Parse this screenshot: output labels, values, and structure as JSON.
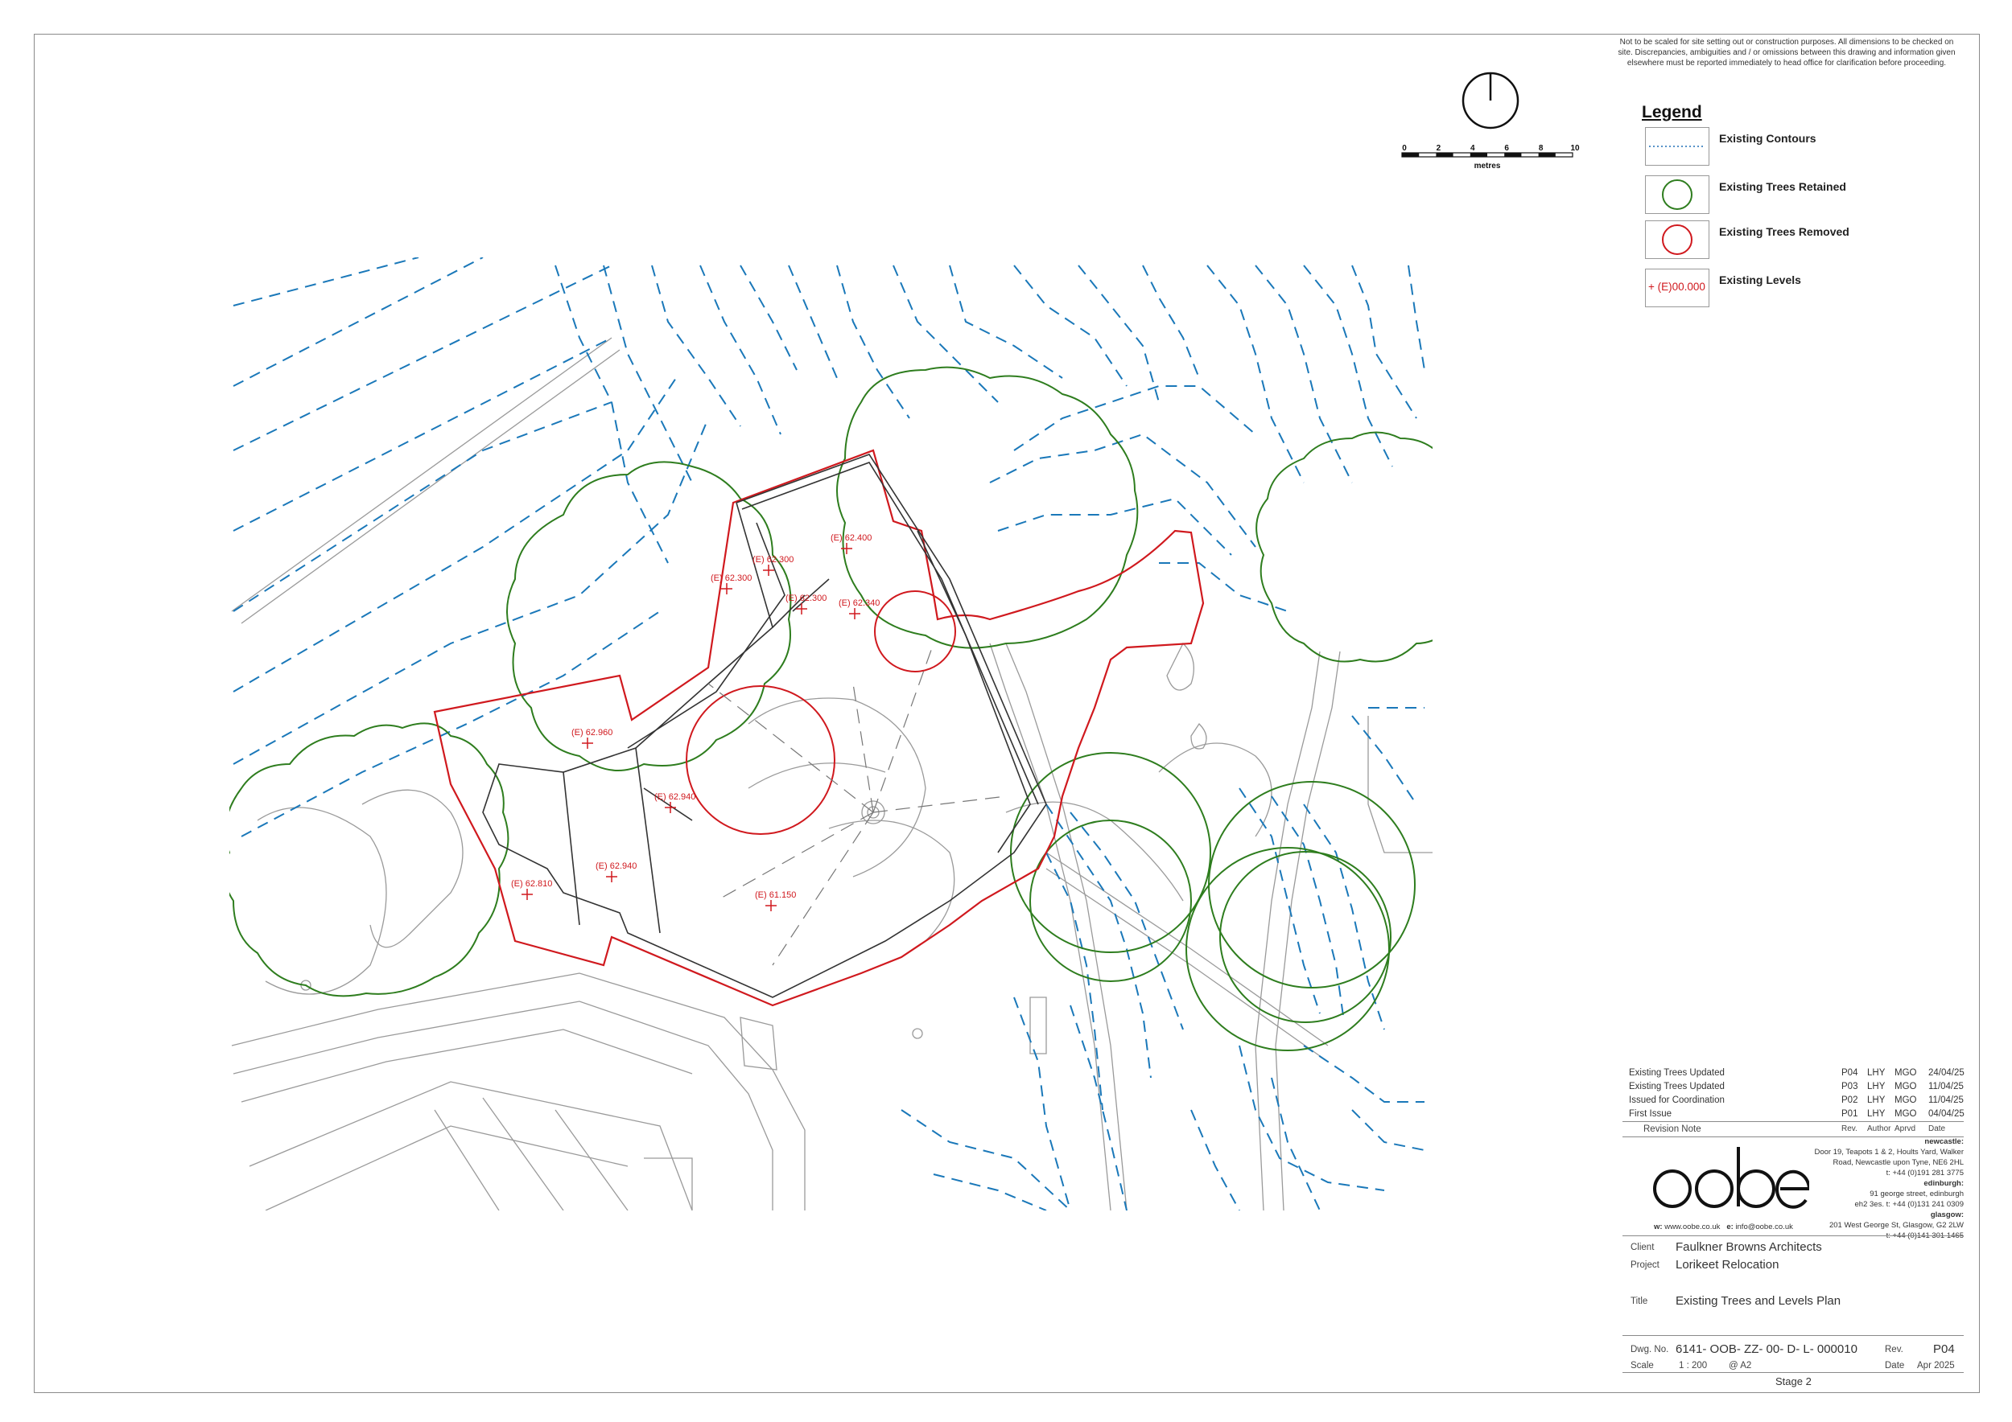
{
  "disclaimer": "Not to be scaled for site setting out or construction purposes. All dimensions to be checked on site. Discrepancies, ambiguities and / or omissions between this drawing and information given elsewhere must be reported immediately to head office for clarification before proceeding.",
  "scale_bar": {
    "ticks": [
      "0",
      "2",
      "4",
      "6",
      "8",
      "10"
    ],
    "unit": "metres"
  },
  "legend": {
    "title": "Legend",
    "items": [
      {
        "label": "Existing Contours",
        "symbol": "dotted-line",
        "color": "#1f6fb5"
      },
      {
        "label": "Existing Trees Retained",
        "symbol": "green-circle",
        "color": "#2e7d1e"
      },
      {
        "label": "Existing Trees Removed",
        "symbol": "red-circle",
        "color": "#d0191e"
      },
      {
        "label": "Existing Levels",
        "symbol": "level-marker",
        "sample": "+ (E)00.000",
        "color": "#d0191e"
      }
    ]
  },
  "levels": [
    {
      "label": "(E) 62.300"
    },
    {
      "label": "(E) 62.300"
    },
    {
      "label": "(E) 62.400"
    },
    {
      "label": "(E) 62.300"
    },
    {
      "label": "(E) 62.340"
    },
    {
      "label": "(E) 62.960"
    },
    {
      "label": "(E) 62.940"
    },
    {
      "label": "(E) 62.940"
    },
    {
      "label": "(E) 62.810"
    },
    {
      "label": "(E) 61.150"
    }
  ],
  "revisions": [
    {
      "note": "Existing Trees Updated",
      "rev": "P04",
      "author": "LHY",
      "approved": "MGO",
      "date": "24/04/25"
    },
    {
      "note": "Existing Trees Updated",
      "rev": "P03",
      "author": "LHY",
      "approved": "MGO",
      "date": "11/04/25"
    },
    {
      "note": "Issued for Coordination",
      "rev": "P02",
      "author": "LHY",
      "approved": "MGO",
      "date": "11/04/25"
    },
    {
      "note": "First Issue",
      "rev": "P01",
      "author": "LHY",
      "approved": "MGO",
      "date": "04/04/25"
    }
  ],
  "revision_headers": {
    "note": "Revision Note",
    "rev": "Rev.",
    "author": "Author",
    "approved": "Aprvd",
    "date": "Date"
  },
  "company": {
    "logo": "oobe",
    "offices": [
      {
        "city": "newcastle:",
        "lines": [
          "Door 19, Teapots 1 & 2, Hoults Yard, Walker",
          "Road, Newcastle upon Tyne, NE6 2HL",
          "t: +44 (0)191 281 3775"
        ]
      },
      {
        "city": "edinburgh:",
        "lines": [
          "91 george street, edinburgh",
          "eh2 3es. t: +44 (0)131 241 0309"
        ]
      },
      {
        "city": "glasgow:",
        "lines": [
          "201 West George St, Glasgow, G2 2LW",
          "t: +44 (0)141 301 1465"
        ]
      }
    ],
    "web_label": "w:",
    "web": "www.oobe.co.uk",
    "email_label": "e:",
    "email": "info@oobe.co.uk"
  },
  "project_info": {
    "client_label": "Client",
    "client": "Faulkner Browns Architects",
    "project_label": "Project",
    "project": "Lorikeet Relocation",
    "title_label": "Title",
    "title": "Existing Trees and Levels Plan"
  },
  "drawing": {
    "dwg_label": "Dwg. No.",
    "dwg_no": "6141- OOB- ZZ- 00- D- L- 000010",
    "rev_label": "Rev.",
    "rev": "P04",
    "scale_label": "Scale",
    "scale": "1 : 200",
    "paper": "@ A2",
    "date_label": "Date",
    "date": "Apr 2025",
    "stage": "Stage 2"
  }
}
